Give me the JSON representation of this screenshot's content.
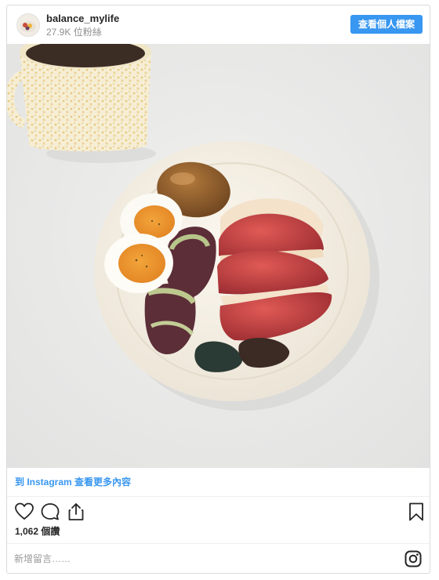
{
  "post": {
    "username": "balance_mylife",
    "followers": "27.9K 位粉絲",
    "profile_button": "查看個人檔案",
    "view_more_link": "到 Instagram 查看更多內容",
    "likes": "1,062 個讚",
    "comment_placeholder": "新增留言……"
  },
  "icons": {
    "like": "heart-icon",
    "comment": "comment-bubble-icon",
    "share": "share-icon",
    "save": "bookmark-icon",
    "instagram": "instagram-logo-icon"
  },
  "colors": {
    "accent": "#3897f0",
    "border": "#dbdbdb",
    "muted": "#8e8e8e"
  }
}
